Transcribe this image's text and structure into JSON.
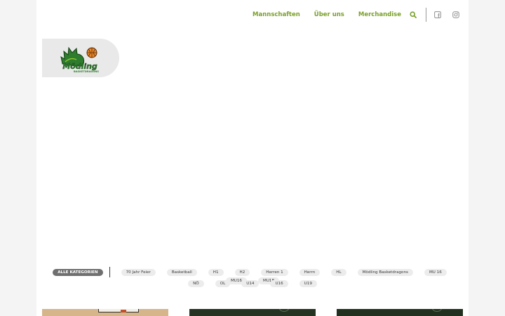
{
  "nav": {
    "links": [
      "Mannschaften",
      "Über uns",
      "Merchandise"
    ],
    "search_icon": "search-icon",
    "social": [
      "facebook-icon",
      "instagram-icon"
    ]
  },
  "logo": {
    "wordmark": "Mödling",
    "subtitle": "BASKETDRAGONS"
  },
  "colors": {
    "accent": "#7aa02a",
    "active_filter": "#6f6f6f",
    "pill": "#ececec"
  },
  "filters": {
    "active": "ALLE KATEGORIEN",
    "row1": [
      "70 Jahr Feier",
      "Basketball",
      "H1",
      "H2",
      "Herren 1",
      "Herrn",
      "HL",
      "Mödling Basketdragons",
      "MU 16",
      "MU16",
      "MU18"
    ],
    "row2": [
      "NÖ",
      "OL",
      "U14",
      "U16",
      "U19"
    ]
  }
}
